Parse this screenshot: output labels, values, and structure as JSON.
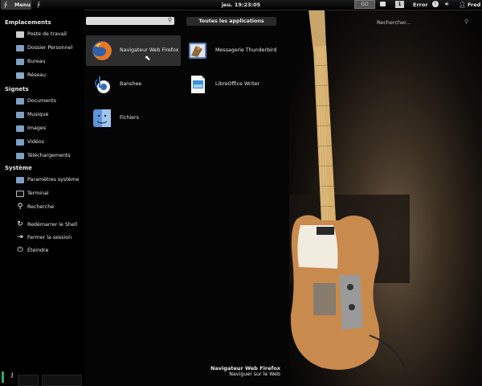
{
  "panel": {
    "menu_label": "Menu",
    "clock": "jeu. 19:23:05",
    "workspace_button": "GO",
    "workspace_number": "1",
    "error_label": "Error",
    "user_name": "Fred"
  },
  "sidebar": {
    "places_heading": "Emplacements",
    "places": [
      "Poste de travail",
      "Dossier Personnel",
      "Bureau",
      "Réseau"
    ],
    "bookmarks_heading": "Signets",
    "bookmarks": [
      "Documents",
      "Musique",
      "Images",
      "Vidéos",
      "Téléchargements"
    ],
    "system_heading": "Système",
    "system": [
      "Paramètres système",
      "Terminal",
      "Recherche"
    ],
    "session": [
      "Redémarrer le Shell",
      "Fermer la session",
      "Éteindre"
    ]
  },
  "search": {
    "placeholder": ""
  },
  "tabs": {
    "all_apps": "Toutes les applications"
  },
  "apps": [
    {
      "name": "Navigateur Web Firefox",
      "icon": "firefox-icon"
    },
    {
      "name": "Messagerie Thunderbird",
      "icon": "thunderbird-icon"
    },
    {
      "name": "Banshee",
      "icon": "banshee-icon"
    },
    {
      "name": "LibreOffice Writer",
      "icon": "writer-icon"
    },
    {
      "name": "Fichiers",
      "icon": "finder-icon"
    }
  ],
  "right_search": {
    "label": "Rechercher..."
  },
  "tooltip": {
    "title": "Navigateur Web Firefox",
    "description": "Naviguer sur le Web"
  },
  "colors": {
    "panel": "#000000",
    "selected_app": "#2e2e2e",
    "folder": "#7fa0c4"
  }
}
